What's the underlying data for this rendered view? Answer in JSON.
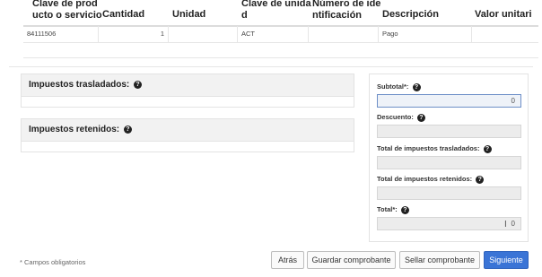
{
  "table": {
    "headers": [
      {
        "line1": "Clave de prod",
        "line2": "ucto o servicio"
      },
      {
        "line1": "Cantidad",
        "line2": ""
      },
      {
        "line1": "Unidad",
        "line2": ""
      },
      {
        "line1": "Clave de unida",
        "line2": "d"
      },
      {
        "line1": "Número de ide",
        "line2": "ntificación"
      },
      {
        "line1": "Descripción",
        "line2": ""
      },
      {
        "line1": "Valor unitari",
        "line2": ""
      }
    ],
    "row": {
      "clave": "84111506",
      "cantidad": "1",
      "unidad": "",
      "clave_unidad": "ACT",
      "numero_id": "",
      "descripcion": "Pago",
      "valor": ""
    }
  },
  "impuestos": {
    "trasladados_label": "Impuestos trasladados:",
    "retenidos_label": "Impuestos retenidos:"
  },
  "totals": {
    "subtotal_label": "Subtotal*:",
    "subtotal_value": "0",
    "descuento_label": "Descuento:",
    "descuento_value": "",
    "total_trasladados_label": "Total de impuestos trasladados:",
    "total_trasladados_value": "",
    "total_retenidos_label": "Total de impuestos retenidos:",
    "total_retenidos_value": "",
    "total_label": "Total*:",
    "total_value": "0"
  },
  "footer": {
    "required_note": "* Campos obligatorios",
    "atras": "Atrás",
    "guardar": "Guardar comprobante",
    "sellar": "Sellar comprobante",
    "siguiente": "Siguiente"
  },
  "colors": {
    "primary": "#3a74d6",
    "panel_header": "#f2f2f2",
    "input_bg": "#ececec"
  },
  "icons": {
    "help": "question-circle-icon"
  }
}
